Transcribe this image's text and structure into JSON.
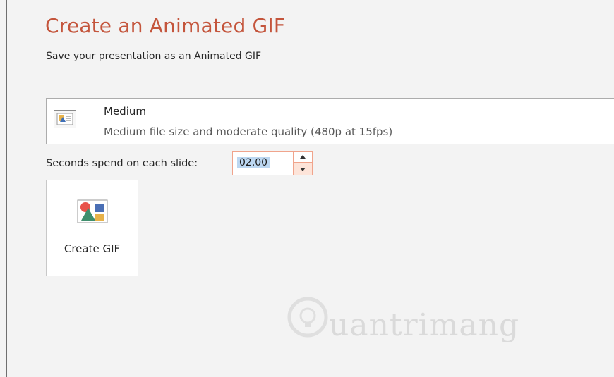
{
  "header": {
    "title": "Create an Animated GIF",
    "subtitle": "Save your presentation as an Animated GIF"
  },
  "quality": {
    "icon": "slide-quality-icon",
    "name": "Medium",
    "description": "Medium file size and moderate quality (480p at 15fps)"
  },
  "seconds": {
    "label": "Seconds spend on each slide:",
    "value": "02.00"
  },
  "create_button": {
    "label": "Create GIF",
    "icon": "shapes-icon"
  },
  "watermark": {
    "text": "uantrimang"
  },
  "colors": {
    "title": "#c4553c",
    "spinner_border": "#f0a48c",
    "selection": "#bcd7f1"
  }
}
